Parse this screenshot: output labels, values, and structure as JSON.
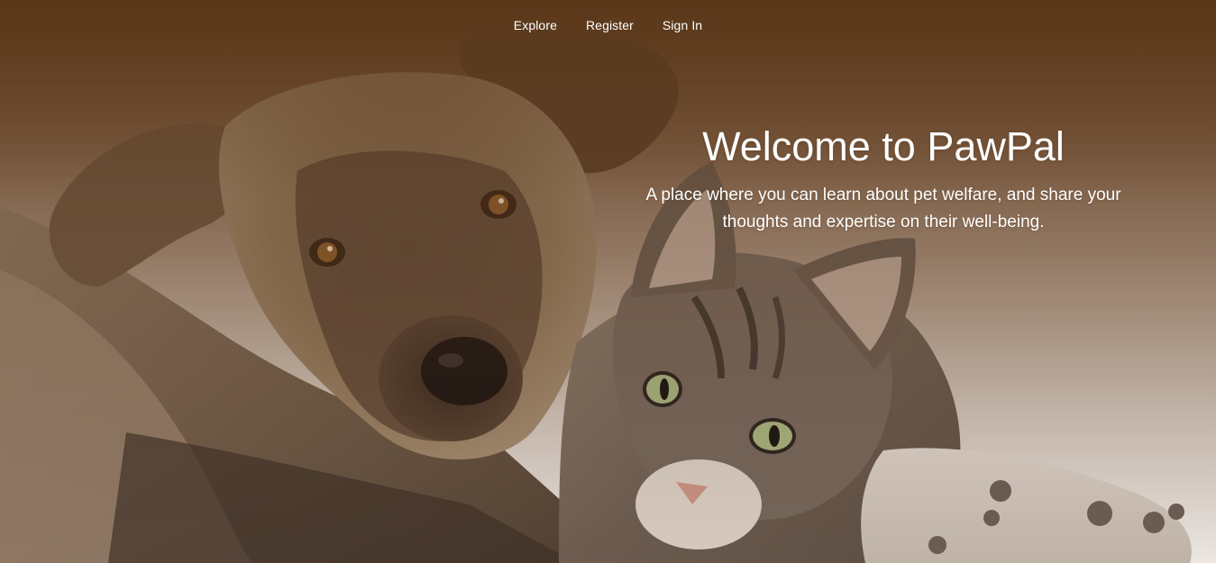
{
  "nav": {
    "items": [
      {
        "label": "Explore"
      },
      {
        "label": "Register"
      },
      {
        "label": "Sign In"
      }
    ]
  },
  "hero": {
    "title": "Welcome to PawPal",
    "subtitle": "A place where you can learn about pet welfare, and share your thoughts and expertise on their well-being."
  },
  "colors": {
    "header_brown": "#5d3a1c",
    "bottom_light": "#ece7e3",
    "text": "#ffffff"
  }
}
